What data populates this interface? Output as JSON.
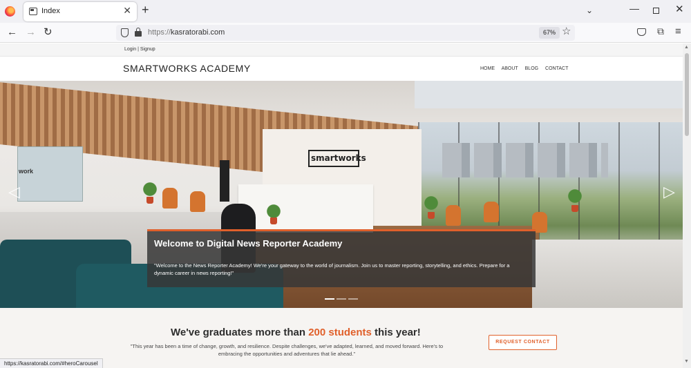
{
  "browser": {
    "tab_title": "Index",
    "url_scheme": "https://",
    "url_host": "kasratorabi.com",
    "zoom": "67%",
    "status_url": "https://kasratorabi.com/#heroCarousel"
  },
  "topbar": {
    "login": "Login",
    "separator": "|",
    "signup": "Signup"
  },
  "header": {
    "logo": "SMARTWORKS ACADEMY",
    "menu": [
      "HOME",
      "ABOUT",
      "BLOG",
      "CONTACT"
    ]
  },
  "hero": {
    "sign_text": "smartworks",
    "room_text": "work",
    "caption_title": "Welcome to Digital News Reporter Academy",
    "caption_text": "\"Welcome to the News Reporter Academy! We're your gateway to the world of journalism. Join us to master reporting, storytelling, and ethics. Prepare for a dynamic career in news reporting!\"",
    "slides": 3,
    "active_slide": 1
  },
  "stats": {
    "heading_pre": "We've graduates more than ",
    "heading_highlight": "200 students",
    "heading_post": " this year!",
    "text": "\"This year has been a time of change, growth, and resilience. Despite challenges, we've adapted, learned, and moved forward. Here's to embracing the opportunities and adventures that lie ahead.\"",
    "cta": "REQUEST CONTACT"
  },
  "colors": {
    "accent": "#e0602b"
  },
  "icons": {
    "back": "arrow-left-icon",
    "forward": "arrow-right-icon",
    "reload": "reload-icon",
    "shield": "shield-icon",
    "lock": "lock-icon",
    "star": "star-icon",
    "pocket": "pocket-icon",
    "extensions": "extensions-icon",
    "menu": "hamburger-icon"
  }
}
